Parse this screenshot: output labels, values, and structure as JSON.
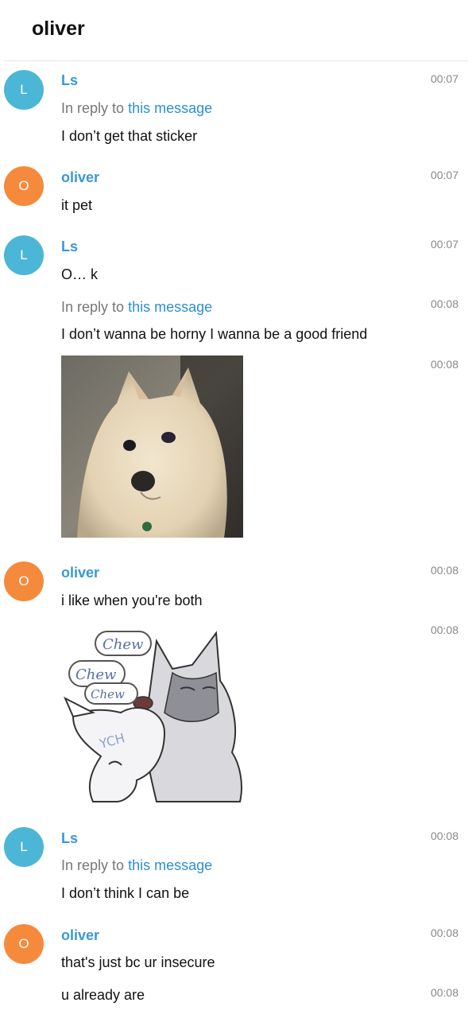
{
  "header": {
    "title": "oliver"
  },
  "messages": [
    {
      "avatar": "L",
      "sender": "Ls",
      "time": "00:07",
      "reply_prefix": "In reply to",
      "reply_link": "this message",
      "text": "I don’t get that sticker"
    },
    {
      "avatar": "O",
      "sender": "oliver",
      "time": "00:07",
      "text": "it pet"
    },
    {
      "avatar": "L",
      "sender": "Ls",
      "time": "00:07",
      "text": "O… k"
    },
    {
      "time": "00:08",
      "reply_prefix": "In reply to",
      "reply_link": "this message",
      "text": "I don’t wanna be horny I wanna be a good friend"
    },
    {
      "time": "00:08",
      "media": "dog-photo"
    },
    {
      "avatar": "O",
      "sender": "oliver",
      "time": "00:08",
      "text": "i like when you're both"
    },
    {
      "time": "00:08",
      "media": "wolf-sticker",
      "sticker_words": [
        "Chew",
        "Chew",
        "Chew",
        "YCH"
      ]
    },
    {
      "avatar": "L",
      "sender": "Ls",
      "time": "00:08",
      "reply_prefix": "In reply to",
      "reply_link": "this message",
      "text": "I don’t think I can be"
    },
    {
      "avatar": "O",
      "sender": "oliver",
      "time": "00:08",
      "text": "that's just bc ur insecure"
    },
    {
      "time": "00:08",
      "text": "u already are"
    }
  ],
  "colors": {
    "ls_avatar": "#4bb6d6",
    "oliver_avatar": "#f58a3c",
    "sender_name": "#3a98d4",
    "link": "#2a8fd4"
  }
}
